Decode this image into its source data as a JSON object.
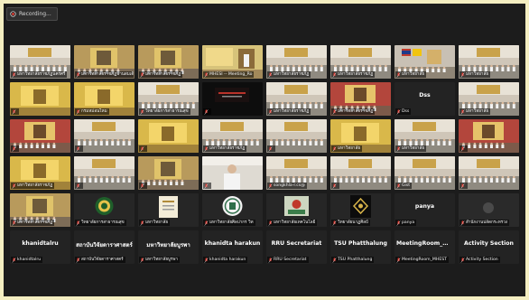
{
  "recording": {
    "label": "Recording..."
  },
  "colors": {
    "window_bg": "#1c1c1c",
    "tile_bg": "#262626",
    "mic_muted": "#e0392f",
    "page_bg": "#f4eec1"
  },
  "tiles": [
    {
      "label": "มหาวิทยาลัยราชภัฏนครศรี",
      "kind": "video",
      "theme": "hall"
    },
    {
      "label": "มหาวิทยาลัยราชภัฏบ้านสมเด็จ",
      "kind": "video",
      "theme": "portrait"
    },
    {
      "label": "มหาวิทยาลัยราชภัฏ",
      "kind": "video",
      "theme": "portrait"
    },
    {
      "label": "MHESI -- Meeting_Ro",
      "kind": "video",
      "theme": "stage"
    },
    {
      "label": "มหาวิทยาลัยราชภัฏ",
      "kind": "video",
      "theme": "hall"
    },
    {
      "label": "มหาวิทยาลัยราชภัฏ",
      "kind": "video",
      "theme": "hall"
    },
    {
      "label": "มหาวิทยาลัย",
      "kind": "video",
      "theme": "flags"
    },
    {
      "label": "มหาวิทยาลัย",
      "kind": "video",
      "theme": "hall"
    },
    {
      "label": "",
      "kind": "video",
      "theme": "gold"
    },
    {
      "label": "กรมหม่อนไหม",
      "kind": "video",
      "theme": "gold"
    },
    {
      "label": "วิทยาลัยการสาธารณสุข",
      "kind": "video",
      "theme": "hall"
    },
    {
      "label": "",
      "kind": "video",
      "theme": "dark"
    },
    {
      "label": "มหาวิทยาลัยราชภัฏ",
      "kind": "video",
      "theme": "hall"
    },
    {
      "label": "มหาวิทยาลัยราชภัฏ",
      "kind": "video",
      "theme": "red"
    },
    {
      "label": "Dss",
      "kind": "name",
      "name": "Dss"
    },
    {
      "label": "มหาวิทยาลัย",
      "kind": "video",
      "theme": "hall"
    },
    {
      "label": "",
      "kind": "video",
      "theme": "red"
    },
    {
      "label": "",
      "kind": "video",
      "theme": "hall"
    },
    {
      "label": "",
      "kind": "video",
      "theme": "gold"
    },
    {
      "label": "มหาวิทยาลัยราชภัฏ",
      "kind": "video",
      "theme": "hall"
    },
    {
      "label": "",
      "kind": "video",
      "theme": "hall"
    },
    {
      "label": "มหาวิทยาลัย",
      "kind": "video",
      "theme": "gold"
    },
    {
      "label": "มหาวิทยาลัย",
      "kind": "video",
      "theme": "hall"
    },
    {
      "label": "",
      "kind": "video",
      "theme": "red"
    },
    {
      "label": "มหาวิทยาลัยราชภัฏ",
      "kind": "video",
      "theme": "gold"
    },
    {
      "label": "",
      "kind": "video",
      "theme": "hall"
    },
    {
      "label": "",
      "kind": "video",
      "theme": "portrait"
    },
    {
      "label": "",
      "kind": "video",
      "theme": "person"
    },
    {
      "label": "songkhla-r.cs@",
      "kind": "video",
      "theme": "hall"
    },
    {
      "label": "",
      "kind": "video",
      "theme": "hall"
    },
    {
      "label": "Gist",
      "kind": "video",
      "theme": "hall"
    },
    {
      "label": "",
      "kind": "video",
      "theme": "hall"
    },
    {
      "label": "มหาวิทยาลัยราชภัฏ",
      "kind": "video",
      "theme": "portrait"
    },
    {
      "label": "วิทยาลัยการสาธารณสุข",
      "kind": "video",
      "theme": "logo_green"
    },
    {
      "label": "มหาวิทยาลัย",
      "kind": "video",
      "theme": "logo_doc"
    },
    {
      "label": "มหาวิทยาลัยศิลปากร วิท",
      "kind": "video",
      "theme": "logo_seal"
    },
    {
      "label": "มหาวิทยาลัยเทคโนโลยี",
      "kind": "video",
      "theme": "logo_photo"
    },
    {
      "label": "วิทยาลัยนาฏศิลป์",
      "kind": "video",
      "theme": "logo_dark"
    },
    {
      "label": "panya",
      "kind": "name",
      "name": "panya"
    },
    {
      "label": "สำนักงานปลัดกระทรวง",
      "kind": "video",
      "theme": "dark2"
    },
    {
      "label": "khanidtalru",
      "kind": "name",
      "name": "khanidtalru"
    },
    {
      "label": "สถาบันวิจัยดาราศาสตร์",
      "kind": "name",
      "name": "สถาบันวิจัยดาราศาสตร์"
    },
    {
      "label": "มหาวิทยาลัยบูรพา",
      "kind": "name",
      "name": "มหาวิทยาลัยบูรพา"
    },
    {
      "label": "khanidta harakun",
      "kind": "name",
      "name": "khanidta harakun"
    },
    {
      "label": "RRU Secretariat",
      "kind": "name",
      "name": "RRU Secretariat"
    },
    {
      "label": "TSU Phatthalung",
      "kind": "name",
      "name": "TSU Phatthalung"
    },
    {
      "label": "MeetingRoom_MHEST",
      "kind": "name",
      "name": "MeetingRoom_MHEST"
    },
    {
      "label": "Activity Section",
      "kind": "name",
      "name": "Activity Section"
    }
  ]
}
